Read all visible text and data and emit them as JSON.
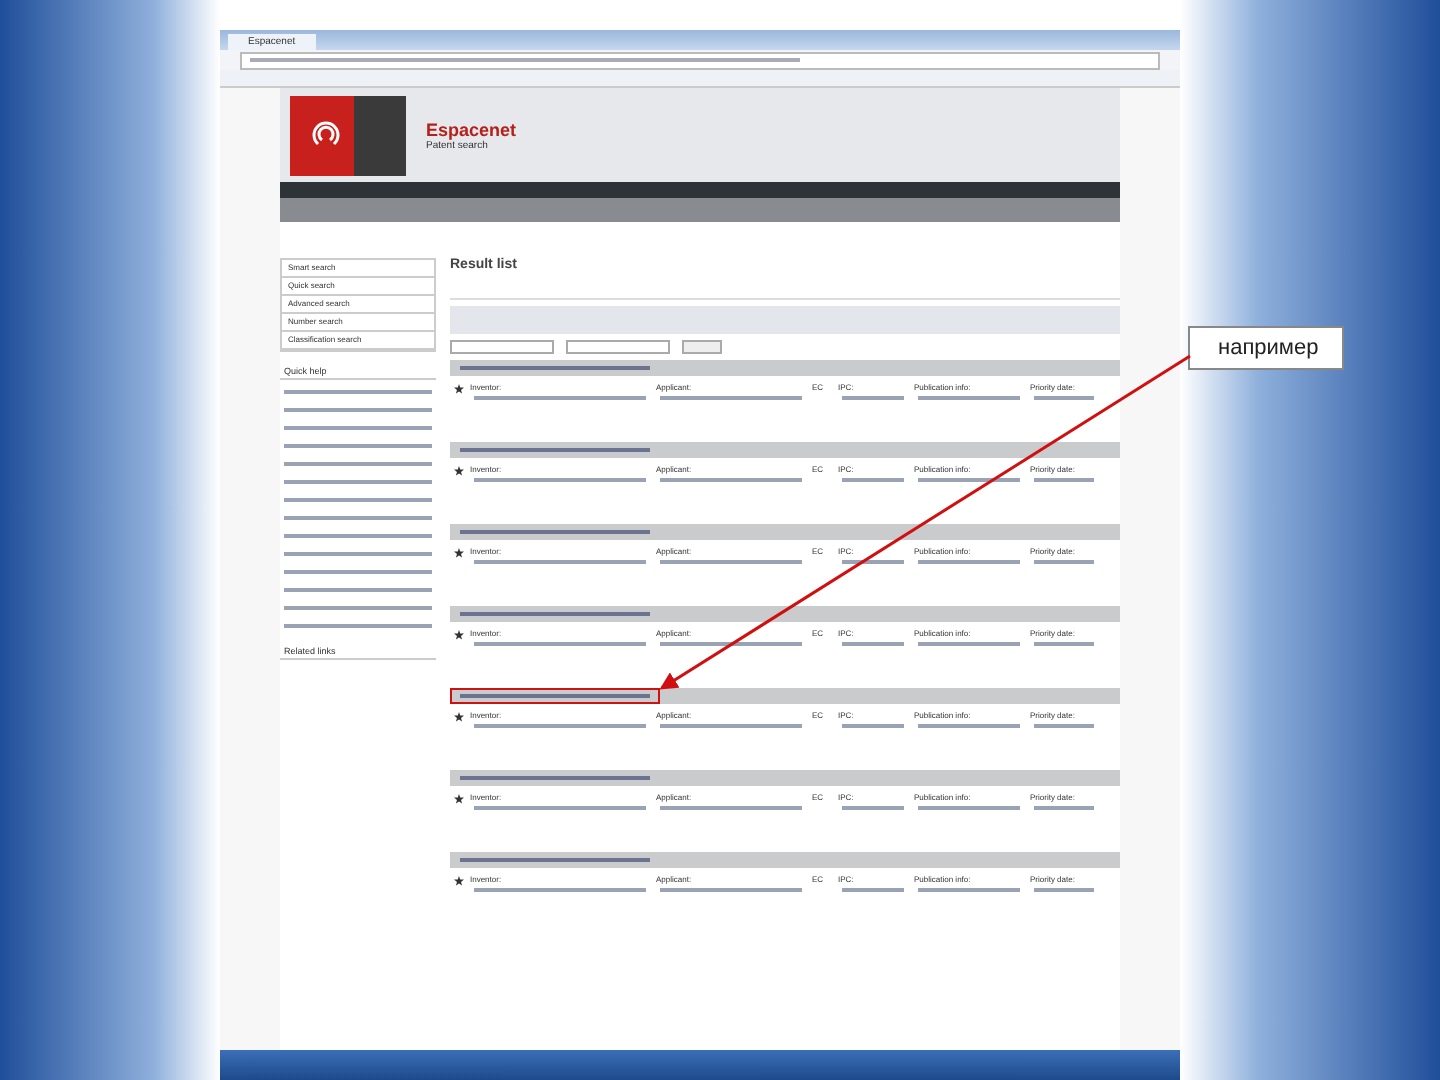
{
  "slide": {
    "callout": "например"
  },
  "browser": {
    "tab_title": "Espacenet"
  },
  "header": {
    "title": "Espacenet",
    "subtitle": "Patent search"
  },
  "sidebar": {
    "items": [
      "Smart search",
      "Quick search",
      "Advanced search",
      "Number search",
      "Classification search"
    ],
    "sections": [
      "Quick help",
      "Related links"
    ]
  },
  "main": {
    "title": "Result list",
    "results": [
      {
        "highlighted": false,
        "labels": [
          "Inventor:",
          "Applicant:",
          "EC",
          "IPC:",
          "Publication info:",
          "Priority date:"
        ]
      },
      {
        "highlighted": false,
        "labels": [
          "Inventor:",
          "Applicant:",
          "EC",
          "IPC:",
          "Publication info:",
          "Priority date:"
        ]
      },
      {
        "highlighted": false,
        "labels": [
          "Inventor:",
          "Applicant:",
          "EC",
          "IPC:",
          "Publication info:",
          "Priority date:"
        ]
      },
      {
        "highlighted": false,
        "labels": [
          "Inventor:",
          "Applicant:",
          "EC",
          "IPC:",
          "Publication info:",
          "Priority date:"
        ]
      },
      {
        "highlighted": true,
        "labels": [
          "Inventor:",
          "Applicant:",
          "EC",
          "IPC:",
          "Publication info:",
          "Priority date:"
        ]
      },
      {
        "highlighted": false,
        "labels": [
          "Inventor:",
          "Applicant:",
          "EC",
          "IPC:",
          "Publication info:",
          "Priority date:"
        ]
      },
      {
        "highlighted": false,
        "labels": [
          "Inventor:",
          "Applicant:",
          "EC",
          "IPC:",
          "Publication info:",
          "Priority date:"
        ]
      }
    ]
  }
}
